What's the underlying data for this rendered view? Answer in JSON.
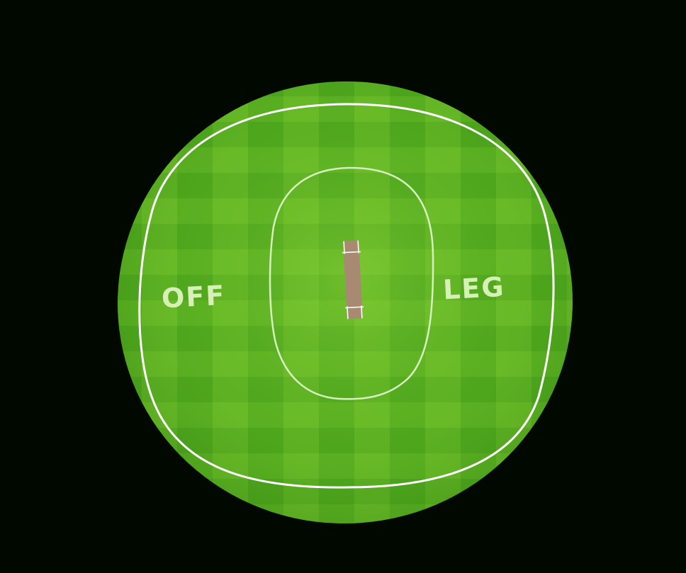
{
  "field": {
    "off_label": "OFF",
    "leg_label": "LEG"
  },
  "colors": {
    "background": "#000800",
    "grass_dark": "#3c9a17",
    "grass_light": "#7cc82e",
    "boundary_line": "#ffffff",
    "inner_circle": "#d6f0c0",
    "pitch": "#a88a72",
    "crease": "#ffffff"
  }
}
